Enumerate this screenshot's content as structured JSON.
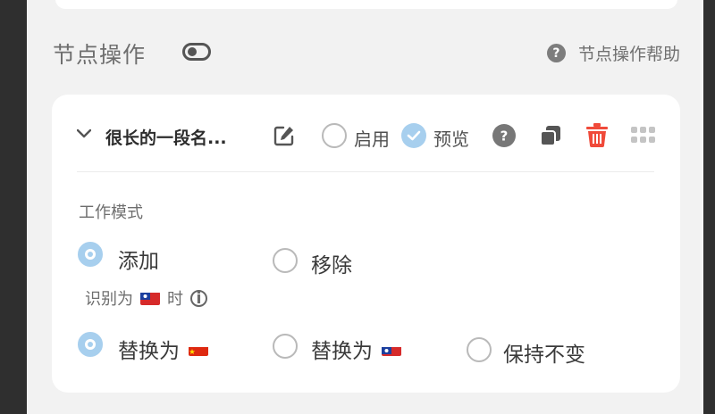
{
  "section": {
    "title": "节点操作",
    "help_label": "节点操作帮助"
  },
  "node": {
    "name": "很长的一段名...",
    "enable_label": "启用",
    "preview_label": "预览",
    "enabled": false,
    "preview_checked": true
  },
  "work_mode": {
    "label": "工作模式",
    "options": [
      {
        "label": "添加",
        "selected": true
      },
      {
        "label": "移除",
        "selected": false
      }
    ]
  },
  "condition": {
    "prefix": "识别为",
    "flag": "taiwan-flag",
    "suffix": "时",
    "options": [
      {
        "label": "替换为",
        "flag": "china-flag",
        "selected": true
      },
      {
        "label": "替换为",
        "flag": "taiwan-flag",
        "selected": false
      },
      {
        "label": "保持不变",
        "selected": false
      }
    ]
  },
  "colors": {
    "accent": "#a7cfee",
    "delete": "#f04a3a",
    "card_bg": "#ffffff",
    "panel_bg": "#f2f2f2"
  }
}
